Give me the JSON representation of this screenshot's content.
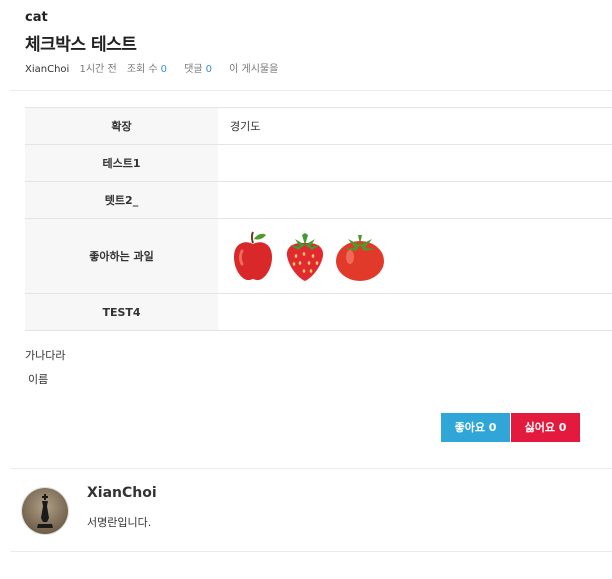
{
  "post": {
    "category": "cat",
    "title": "체크박스 테스트",
    "author": "XianChoi",
    "time": "1시간 전",
    "views_label": "조회 수",
    "views": "0",
    "comments_label": "댓글",
    "comments": "0",
    "permalink_label": "이 게시물을"
  },
  "fields": [
    {
      "label": "확장",
      "value": "경기도"
    },
    {
      "label": "테스트1",
      "value": ""
    },
    {
      "label": "텟트2_",
      "value": ""
    },
    {
      "label": "좋아하는 과일",
      "icons": [
        "apple-icon",
        "strawberry-icon",
        "tomato-icon"
      ]
    },
    {
      "label": "TEST4",
      "value": ""
    }
  ],
  "extra": {
    "line1": "가나다라",
    "line2": "이름"
  },
  "buttons": {
    "like": "좋아요 0",
    "dislike": "싫어요 0"
  },
  "signature": {
    "name": "XianChoi",
    "text": "서명란입니다."
  },
  "colors": {
    "like": "#2fa5d8",
    "dislike": "#e3193e",
    "count": "#3a8fd0"
  }
}
